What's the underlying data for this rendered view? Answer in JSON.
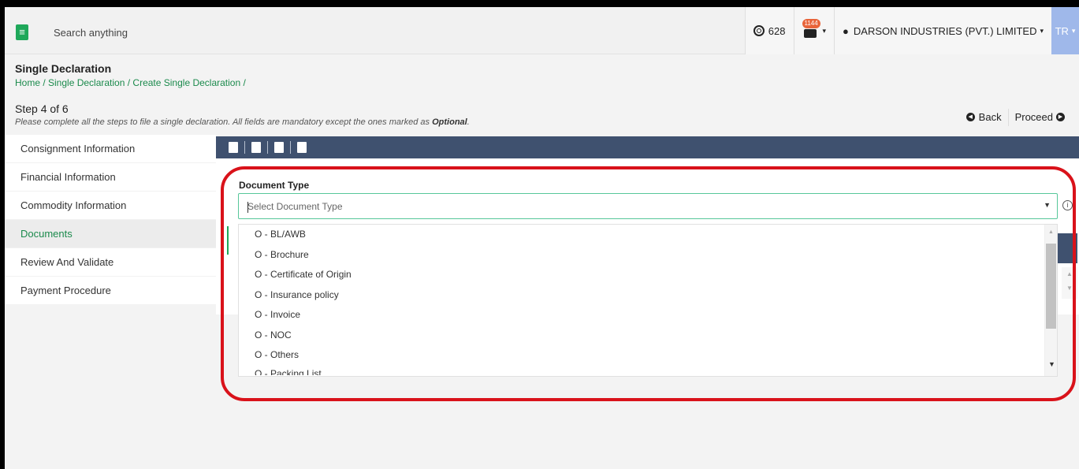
{
  "topbar": {
    "search_placeholder": "Search anything",
    "coins": "628",
    "mail_count": "1144",
    "company": "DARSON INDUSTRIES (PVT.) LIMITED",
    "avatar": "TR"
  },
  "header": {
    "title": "Single Declaration",
    "breadcrumb": "Home / Single Declaration / Create Single Declaration /",
    "step": "Step 4 of 6",
    "description_prefix": "Please complete all the steps to file a single declaration. All fields are mandatory except the ones marked as ",
    "description_emphasis": "Optional",
    "description_suffix": ".",
    "back_label": "Back",
    "proceed_label": "Proceed"
  },
  "sidebar": {
    "items": [
      {
        "label": "Consignment Information"
      },
      {
        "label": "Financial Information"
      },
      {
        "label": "Commodity Information"
      },
      {
        "label": "Documents"
      },
      {
        "label": "Review And Validate"
      },
      {
        "label": "Payment Procedure"
      }
    ]
  },
  "document_form": {
    "label": "Document Type",
    "placeholder": "Select Document Type",
    "options": [
      "O - BL/AWB",
      "O - Brochure",
      "O - Certificate of Origin",
      "O - Insurance policy",
      "O - Invoice",
      "O - NOC",
      "O - Others",
      "O - Packing List"
    ]
  },
  "colors": {
    "accent_green": "#1fa85a",
    "toolbar_navy": "#3f516f",
    "highlight_red": "#d9121a"
  }
}
